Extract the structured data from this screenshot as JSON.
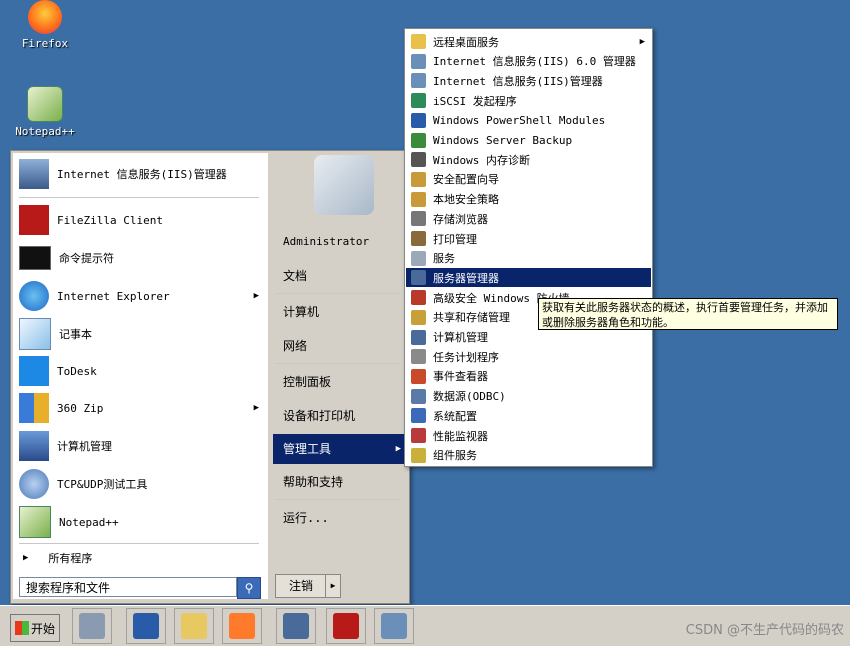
{
  "desktop": {
    "icons": [
      {
        "label": "Firefox",
        "icon": "firefox-icon"
      },
      {
        "label": "Notepad++",
        "icon": "notepad-plus-plus-icon"
      }
    ]
  },
  "start_menu": {
    "pinned": [
      {
        "label": "Internet 信息服务(IIS)管理器",
        "icon": "iis-manager-icon"
      },
      {
        "label": "FileZilla Client",
        "icon": "filezilla-icon"
      },
      {
        "label": "命令提示符",
        "icon": "command-prompt-icon"
      },
      {
        "label": "Internet Explorer",
        "icon": "internet-explorer-icon"
      },
      {
        "label": "记事本",
        "icon": "notepad-icon"
      },
      {
        "label": "ToDesk",
        "icon": "todesk-icon"
      },
      {
        "label": "360 Zip",
        "icon": "zip-icon"
      },
      {
        "label": "计算机管理",
        "icon": "computer-management-icon"
      },
      {
        "label": "TCP&UDP测试工具",
        "icon": "tcp-udp-tool-icon"
      },
      {
        "label": "Notepad++",
        "icon": "notepad-plus-plus-icon"
      }
    ],
    "all_programs": "所有程序",
    "search_placeholder": "搜索程序和文件",
    "right": {
      "user": "Administrator",
      "documents": "文档",
      "computer": "计算机",
      "network": "网络",
      "control_panel": "控制面板",
      "devices": "设备和打印机",
      "admin_tools": "管理工具",
      "help": "帮助和支持",
      "run": "运行..."
    },
    "logoff": "注销"
  },
  "submenu": {
    "items": [
      {
        "label": "远程桌面服务",
        "icon": "folder-icon",
        "color": "#e8c04a"
      },
      {
        "label": "Internet 信息服务(IIS) 6.0 管理器",
        "icon": "iis6-icon",
        "color": "#6a8fb8"
      },
      {
        "label": "Internet 信息服务(IIS)管理器",
        "icon": "iis-manager-icon",
        "color": "#6a8fb8"
      },
      {
        "label": "iSCSI 发起程序",
        "icon": "iscsi-icon",
        "color": "#2d8a5a"
      },
      {
        "label": "Windows PowerShell Modules",
        "icon": "powershell-icon",
        "color": "#2a5ba8"
      },
      {
        "label": "Windows Server Backup",
        "icon": "backup-icon",
        "color": "#3c8a3c"
      },
      {
        "label": "Windows 内存诊断",
        "icon": "memory-diagnostic-icon",
        "color": "#555555"
      },
      {
        "label": "安全配置向导",
        "icon": "security-wizard-icon",
        "color": "#c89a3a"
      },
      {
        "label": "本地安全策略",
        "icon": "local-security-icon",
        "color": "#c89a3a"
      },
      {
        "label": "存储浏览器",
        "icon": "storage-explorer-icon",
        "color": "#777777"
      },
      {
        "label": "打印管理",
        "icon": "print-management-icon",
        "color": "#8a6a3a"
      },
      {
        "label": "服务",
        "icon": "services-icon",
        "color": "#9aa8b8"
      },
      {
        "label": "服务器管理器",
        "icon": "server-manager-icon",
        "color": "#4a6a9a"
      },
      {
        "label": "高级安全 Windows 防火墙",
        "icon": "firewall-icon",
        "color": "#b83a2a"
      },
      {
        "label": "共享和存储管理",
        "icon": "share-storage-icon",
        "color": "#c8a03a"
      },
      {
        "label": "计算机管理",
        "icon": "computer-management-icon",
        "color": "#4a6a9a"
      },
      {
        "label": "任务计划程序",
        "icon": "task-scheduler-icon",
        "color": "#8a8a8a"
      },
      {
        "label": "事件查看器",
        "icon": "event-viewer-icon",
        "color": "#c84a2a"
      },
      {
        "label": "数据源(ODBC)",
        "icon": "odbc-icon",
        "color": "#5a7aa8"
      },
      {
        "label": "系统配置",
        "icon": "system-config-icon",
        "color": "#3a6ab8"
      },
      {
        "label": "性能监视器",
        "icon": "performance-monitor-icon",
        "color": "#b83a3a"
      },
      {
        "label": "组件服务",
        "icon": "component-services-icon",
        "color": "#c8b03a"
      }
    ],
    "tooltip": "获取有关此服务器状态的概述，执行首要管理任务，并添加或删除服务器角色和功能。"
  },
  "taskbar": {
    "start_label": "开始",
    "buttons": [
      {
        "icon": "server-manager-icon"
      },
      {
        "icon": "powershell-icon"
      },
      {
        "icon": "file-explorer-icon"
      },
      {
        "icon": "firefox-icon"
      },
      {
        "icon": "computer-management-icon"
      },
      {
        "icon": "filezilla-icon"
      },
      {
        "icon": "iis-manager-icon"
      }
    ]
  },
  "watermark": "CSDN @不生产代码的码农"
}
